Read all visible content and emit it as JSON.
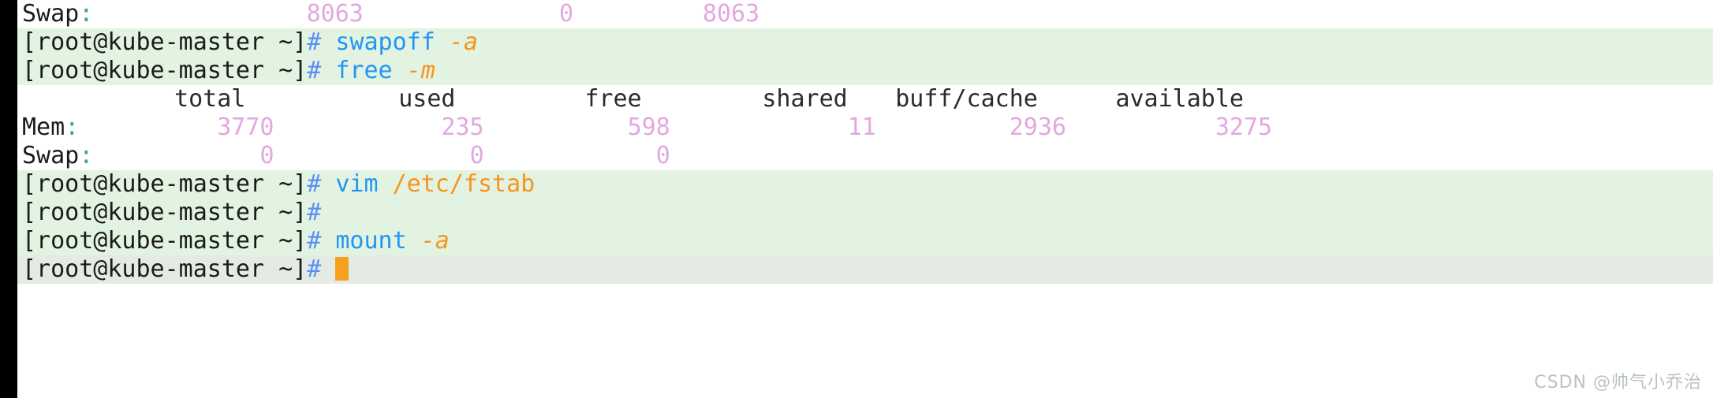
{
  "terminal": {
    "host_prompt": "[root@kube-master ~]",
    "prompt_symbol": "#",
    "cursor": "block-cursor"
  },
  "lines": [
    {
      "kind": "swap-row-partial",
      "label": "Swap",
      "colon": ":",
      "values": [
        "8063",
        "0",
        "8063"
      ]
    },
    {
      "kind": "command",
      "command": "swapoff",
      "args": "-a"
    },
    {
      "kind": "command",
      "command": "free",
      "args": "-m"
    },
    {
      "kind": "table-header",
      "columns": [
        "total",
        "used",
        "free",
        "shared",
        "buff/cache",
        "available"
      ]
    },
    {
      "kind": "table-row",
      "label": "Mem",
      "colon": ":",
      "values": [
        "3770",
        "235",
        "598",
        "11",
        "2936",
        "3275"
      ]
    },
    {
      "kind": "table-row",
      "label": "Swap",
      "colon": ":",
      "values": [
        "0",
        "0",
        "0"
      ]
    },
    {
      "kind": "command",
      "command": "vim",
      "args": "/etc/fstab"
    },
    {
      "kind": "command-empty",
      "command": "",
      "args": ""
    },
    {
      "kind": "command",
      "command": "mount",
      "args": "-a"
    },
    {
      "kind": "command-cursor",
      "command": "",
      "args": ""
    }
  ],
  "watermark": {
    "text": "CSDN @帅气小乔治"
  },
  "colors": {
    "prompt_bg": "#e3f3e1",
    "prompt_bg_dim": "#e4ebe4",
    "output_bg": "#ffffff",
    "command_blue": "#2196f3",
    "flag_orange": "#f7941d",
    "number_violet": "#e2a8e0",
    "colon_green": "#3aab6e",
    "cursor_orange": "#f7a01c",
    "gutter_black": "#000000"
  }
}
